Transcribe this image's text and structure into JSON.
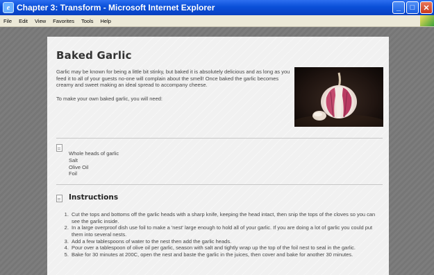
{
  "window": {
    "title": "Chapter 3: Transform - Microsoft Internet Explorer",
    "icon": "ie-icon",
    "controls": [
      "minimize-icon",
      "maximize-icon",
      "close-icon"
    ]
  },
  "menu": {
    "items": [
      "File",
      "Edit",
      "View",
      "Favorites",
      "Tools",
      "Help"
    ]
  },
  "page": {
    "title": "Baked Garlic",
    "intro": "Garlic may be known for being a little bit stinky, but baked it is absolutely delicious and as long as you feed it to all of your guests no-one will complain about the smell! Once baked the garlic becomes creamy and sweet making an ideal spread to accompany cheese.",
    "need": "To make your own baked garlic, you will need:",
    "ingredients": [
      "Whole heads of garlic",
      "Salt",
      "Olive Oil",
      "Foil"
    ],
    "instructions_heading": "Instructions",
    "steps": [
      "Cut the tops and bottoms off the garlic heads with a sharp knife, keeping the head intact, then snip the tops of the cloves so you can see the garlic inside.",
      "In a large overproof dish use foil to make a 'nest' large enough to hold all of your garlic. If you are doing a lot of garlic you could put them into several nests.",
      "Add a few tablespoons of water to the nest then add the garlic heads.",
      "Pour over a tablespoon of olive oil per garlic, season with salt and tightly wrap up the top of the foil nest to seal in the garlic.",
      "Bake for 30 minutes at 200C, open the nest and baste the garlic in the juices, then cover and bake for another 30 minutes."
    ]
  },
  "colors": {
    "titlebar": "#0a4fd8",
    "page_bg": "#f1f1f1",
    "backdrop": "#7a7a7a"
  }
}
